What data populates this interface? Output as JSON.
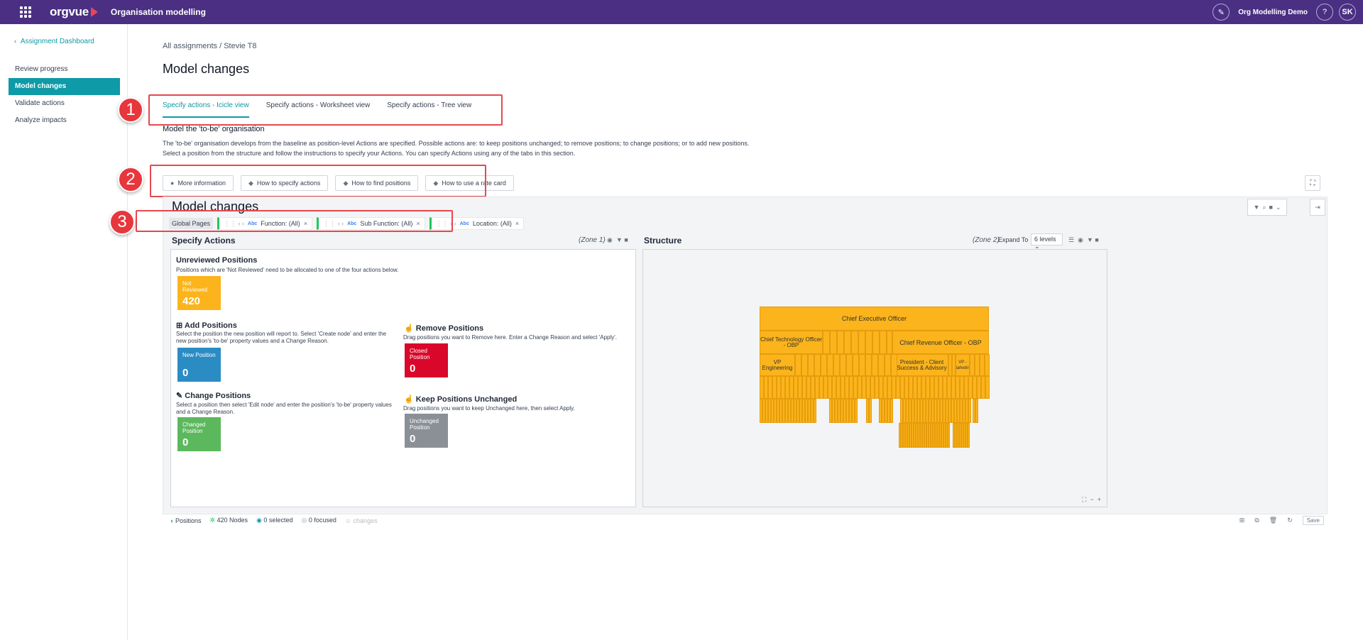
{
  "topbar": {
    "logo": "orgvue",
    "app_title": "Organisation modelling",
    "org_name": "Org Modelling Demo",
    "help": "?",
    "avatar": "SK"
  },
  "sidebar": {
    "back_label": "Assignment Dashboard",
    "items": [
      {
        "label": "Review progress"
      },
      {
        "label": "Model changes"
      },
      {
        "label": "Validate actions"
      },
      {
        "label": "Analyze impacts"
      }
    ]
  },
  "main": {
    "breadcrumb": "All assignments / Stevie T8",
    "title": "Model changes",
    "tabs": [
      {
        "label": "Specify actions - Icicle view"
      },
      {
        "label": "Specify actions - Worksheet view"
      },
      {
        "label": "Specify actions - Tree view"
      }
    ],
    "subtitle": "Model the 'to-be' organisation",
    "desc1": "The 'to-be' organisation develops from the baseline as position-level Actions are specified. Possible actions are:  to keep positions unchanged; to remove positions; to change positions; or to add new positions.",
    "desc2": "Select a position from the structure and follow the instructions to specify your Actions. You can specify Actions using any of the tabs in this section.",
    "help_buttons": [
      {
        "label": "More information"
      },
      {
        "label": "How to specify actions"
      },
      {
        "label": "How to find positions"
      },
      {
        "label": "How to use a rate card"
      }
    ],
    "callouts": [
      "1",
      "2",
      "3"
    ]
  },
  "panel": {
    "title": "Model changes",
    "global_pages": "Global Pages",
    "filters": [
      {
        "label": "Function: (All)"
      },
      {
        "label": "Sub Function: (All)"
      },
      {
        "label": "Location: (All)"
      }
    ],
    "zone1": {
      "title": "Specify Actions",
      "zone_label": "(Zone 1)",
      "unreviewed_title": "Unreviewed Positions",
      "unreviewed_desc": "Positions which are 'Not Reviewed' need to be allocated to one of the four actions below.",
      "not_reviewed_label": "Not Reviewed",
      "not_reviewed_value": "420",
      "add_title": "Add Positions",
      "add_desc": "Select the position the new position will report to. Select 'Create node' and  enter the new position's 'to-be' property values and a Change Reason.",
      "new_label": "New Position",
      "new_value": "0",
      "change_title": "Change Positions",
      "change_desc": "Select a position then select 'Edit node' and enter the position's 'to-be' property values and a Change Reason.",
      "changed_label": "Changed Position",
      "changed_value": "0",
      "remove_title": "Remove Positions",
      "remove_desc": "Drag positions you want to Remove here. Enter a Change Reason and select 'Apply'.",
      "closed_label": "Closed Position",
      "closed_value": "0",
      "keep_title": "Keep Positions Unchanged",
      "keep_desc": "Drag positions you want to keep Unchanged here, then select Apply.",
      "unchanged_label": "Unchanged Position",
      "unchanged_value": "0"
    },
    "zone2": {
      "title": "Structure",
      "zone_label": "(Zone 2)",
      "expand_to": "Expand To",
      "levels": "6 levels",
      "ceo": "Chief Executive Officer",
      "cto": "Chief Technology Officer - OBP",
      "cro": "Chief Revenue Officer - OBP",
      "vp_eng": "VP Engineering",
      "president": "President - Client Success & Advisory",
      "vp_marketing": "VP - Marketing"
    },
    "status": {
      "positions": "Positions",
      "nodes": "420 Nodes",
      "selected": "0 selected",
      "focused": "0 focused",
      "changes": "changes",
      "save": "Save"
    }
  },
  "colors": {
    "topbar": "#4a2f83",
    "accent": "#0e9aa7",
    "not_reviewed": "#fbb41b",
    "new": "#2b8cc4",
    "changed": "#5cb85c",
    "closed": "#d9082a",
    "unchanged": "#8a9096"
  }
}
